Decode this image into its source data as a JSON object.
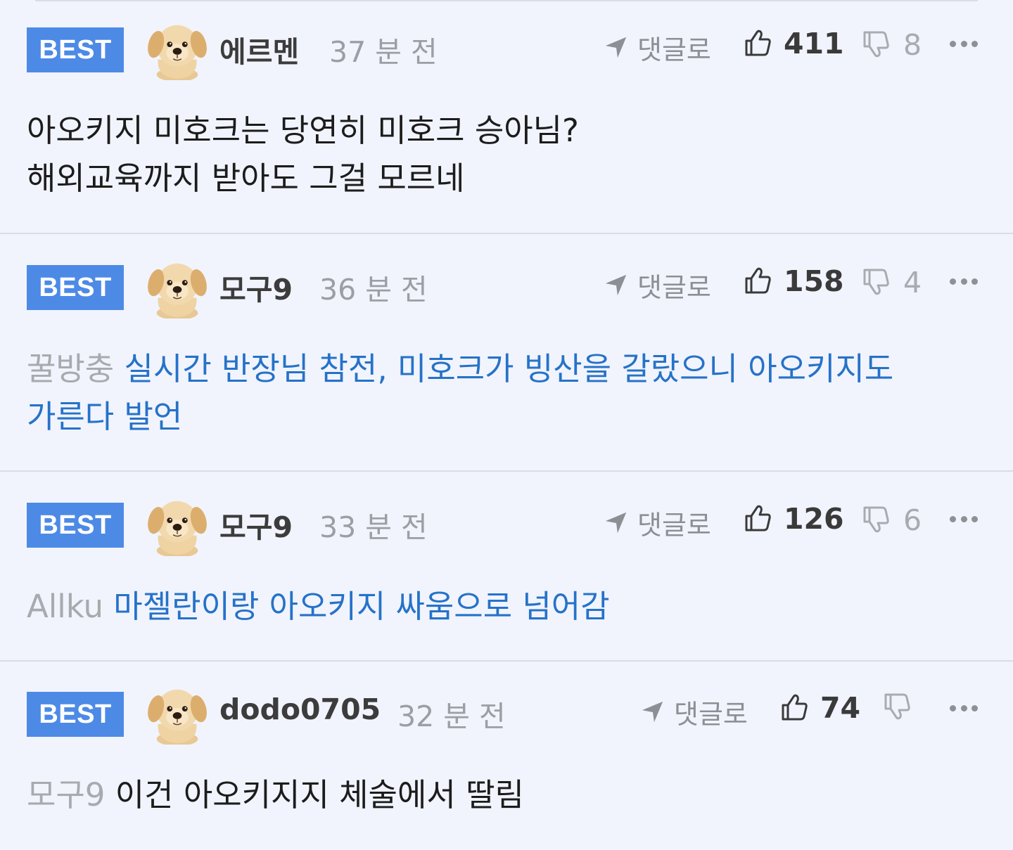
{
  "comments": [
    {
      "badge": "BEST",
      "author": "에르멘",
      "time": "37 분 전",
      "reply_label": "댓글로",
      "likes": "411",
      "dislikes": "8",
      "mention": "",
      "text_line1": "아오키지 미호크는 당연히 미호크 승아님?",
      "text_line2": "해외교육까지 받아도 그걸 모르네"
    },
    {
      "badge": "BEST",
      "author": "모구9",
      "time": "36 분 전",
      "reply_label": "댓글로",
      "likes": "158",
      "dislikes": "4",
      "mention": "꿀방충",
      "text_line1": "실시간 반장님 참전, 미호크가 빙산을 갈랐으니 아오키지도",
      "text_line2": "가른다 발언"
    },
    {
      "badge": "BEST",
      "author": "모구9",
      "time": "33 분 전",
      "reply_label": "댓글로",
      "likes": "126",
      "dislikes": "6",
      "mention": "Allku",
      "text_line1": "마젤란이랑 아오키지 싸움으로 넘어감"
    },
    {
      "badge": "BEST",
      "author": "dodo0705",
      "time": "32 분 전",
      "reply_label": "댓글로",
      "likes": "74",
      "dislikes": "",
      "mention": "모구9",
      "text_line1": "이건 아오키지지 체술에서 딸림"
    }
  ],
  "colors": {
    "background": "#f1f4fd",
    "badge": "#4d8ae6",
    "link_text": "#2672c8",
    "mention": "#a8aaae"
  },
  "icons": {
    "avatar": "puppy-avatar",
    "reply": "send-arrow-icon",
    "like": "thumbs-up-icon",
    "dislike": "thumbs-down-icon",
    "more": "more-dots-icon"
  }
}
